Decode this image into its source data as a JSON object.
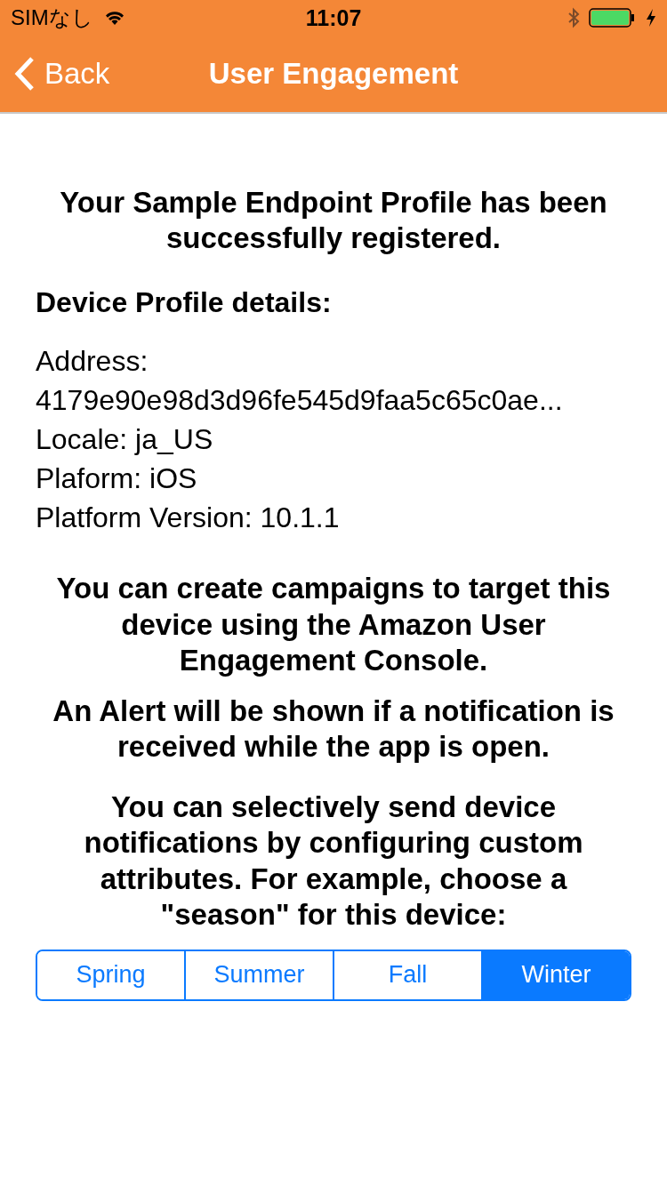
{
  "status_bar": {
    "carrier": "SIMなし",
    "time": "11:07"
  },
  "nav_bar": {
    "back": "Back",
    "title": "User Engagement"
  },
  "heading": "Your Sample Endpoint Profile has been successfully registered.",
  "details_title": "Device Profile details:",
  "details": [
    "Address:",
    "4179e90e98d3d96fe545d9faa5c65c0ae...",
    "Locale: ja_US",
    "Plaform: iOS",
    "Platform Version: 10.1.1"
  ],
  "messages": [
    "You can create campaigns to target this device using the Amazon User Engagement Console.",
    "An Alert will be shown if a notification is received while the app is open.",
    "You can selectively send device notifications by configuring custom attributes. For example, choose a \"season\" for this device:"
  ],
  "segments": [
    {
      "label": "Spring",
      "selected": false
    },
    {
      "label": "Summer",
      "selected": false
    },
    {
      "label": "Fall",
      "selected": false
    },
    {
      "label": "Winter",
      "selected": true
    }
  ]
}
